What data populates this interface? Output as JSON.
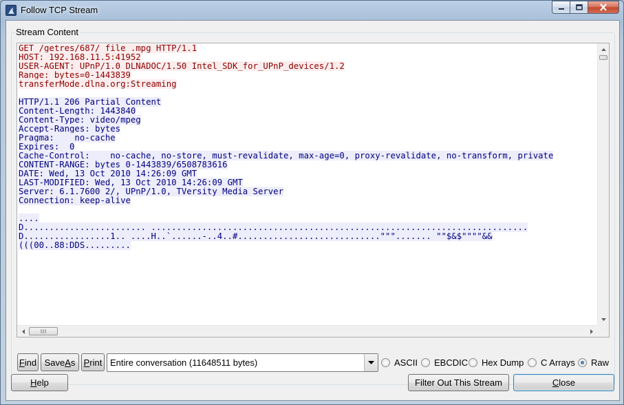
{
  "window": {
    "title": "Follow TCP Stream"
  },
  "group": {
    "label": "Stream Content"
  },
  "stream_lines": [
    {
      "dir": "client",
      "text": "GET /getres/687/_file_.mpg HTTP/1.1"
    },
    {
      "dir": "client",
      "text": "HOST: 192.168.11.5:41952"
    },
    {
      "dir": "client",
      "text": "USER-AGENT: UPnP/1.0 DLNADOC/1.50 Intel_SDK_for_UPnP_devices/1.2"
    },
    {
      "dir": "client",
      "text": "Range: bytes=0-1443839"
    },
    {
      "dir": "client",
      "text": "transferMode.dlna.org:Streaming"
    },
    {
      "dir": "blank",
      "text": ""
    },
    {
      "dir": "server",
      "text": "HTTP/1.1 206 Partial Content"
    },
    {
      "dir": "server",
      "text": "Content-Length: 1443840"
    },
    {
      "dir": "server",
      "text": "Content-Type: video/mpeg"
    },
    {
      "dir": "server",
      "text": "Accept-Ranges: bytes"
    },
    {
      "dir": "server",
      "text": "Pragma:    no-cache"
    },
    {
      "dir": "server",
      "text": "Expires:  0"
    },
    {
      "dir": "server",
      "text": "Cache-Control:    no-cache, no-store, must-revalidate, max-age=0, proxy-revalidate, no-transform, private"
    },
    {
      "dir": "server",
      "text": "CONTENT-RANGE: bytes 0-1443839/6508783616"
    },
    {
      "dir": "server",
      "text": "DATE: Wed, 13 Oct 2010 14:26:09 GMT"
    },
    {
      "dir": "server",
      "text": "LAST-MODIFIED: Wed, 13 Oct 2010 14:26:09 GMT"
    },
    {
      "dir": "server",
      "text": "Server: 6.1.7600 2/, UPnP/1.0, TVersity Media Server"
    },
    {
      "dir": "server",
      "text": "Connection: keep-alive"
    },
    {
      "dir": "blank",
      "text": ""
    },
    {
      "dir": "server",
      "text": "...."
    },
    {
      "dir": "server",
      "text": "D........................ .........................................................................."
    },
    {
      "dir": "server",
      "text": "D.................1.._....H..`......-..4..#............................\"\"\"....... \"\"$&$\"\"\"\"&&"
    },
    {
      "dir": "server",
      "text": "(((00..88:DDS........."
    }
  ],
  "buttons": {
    "find": {
      "pre": "",
      "u": "F",
      "post": "ind"
    },
    "save_as": {
      "pre": "Save ",
      "u": "A",
      "post": "s"
    },
    "print": {
      "pre": "",
      "u": "P",
      "post": "rint"
    },
    "help": {
      "pre": "",
      "u": "H",
      "post": "elp"
    },
    "filter_out": {
      "pre": "Filter Out This Stream",
      "u": "",
      "post": ""
    },
    "close": {
      "pre": "",
      "u": "C",
      "post": "lose"
    }
  },
  "conversation_select": {
    "value": "Entire conversation (11648511 bytes)"
  },
  "formats": [
    {
      "label": "ASCII",
      "checked": false
    },
    {
      "label": "EBCDIC",
      "checked": false
    },
    {
      "label": "Hex Dump",
      "checked": false
    },
    {
      "label": "C Arrays",
      "checked": false
    },
    {
      "label": "Raw",
      "checked": true
    }
  ],
  "colors": {
    "client_text": "#8e0000",
    "client_bg": "#fbeded",
    "server_text": "#00007f",
    "server_bg": "#ededfb"
  }
}
